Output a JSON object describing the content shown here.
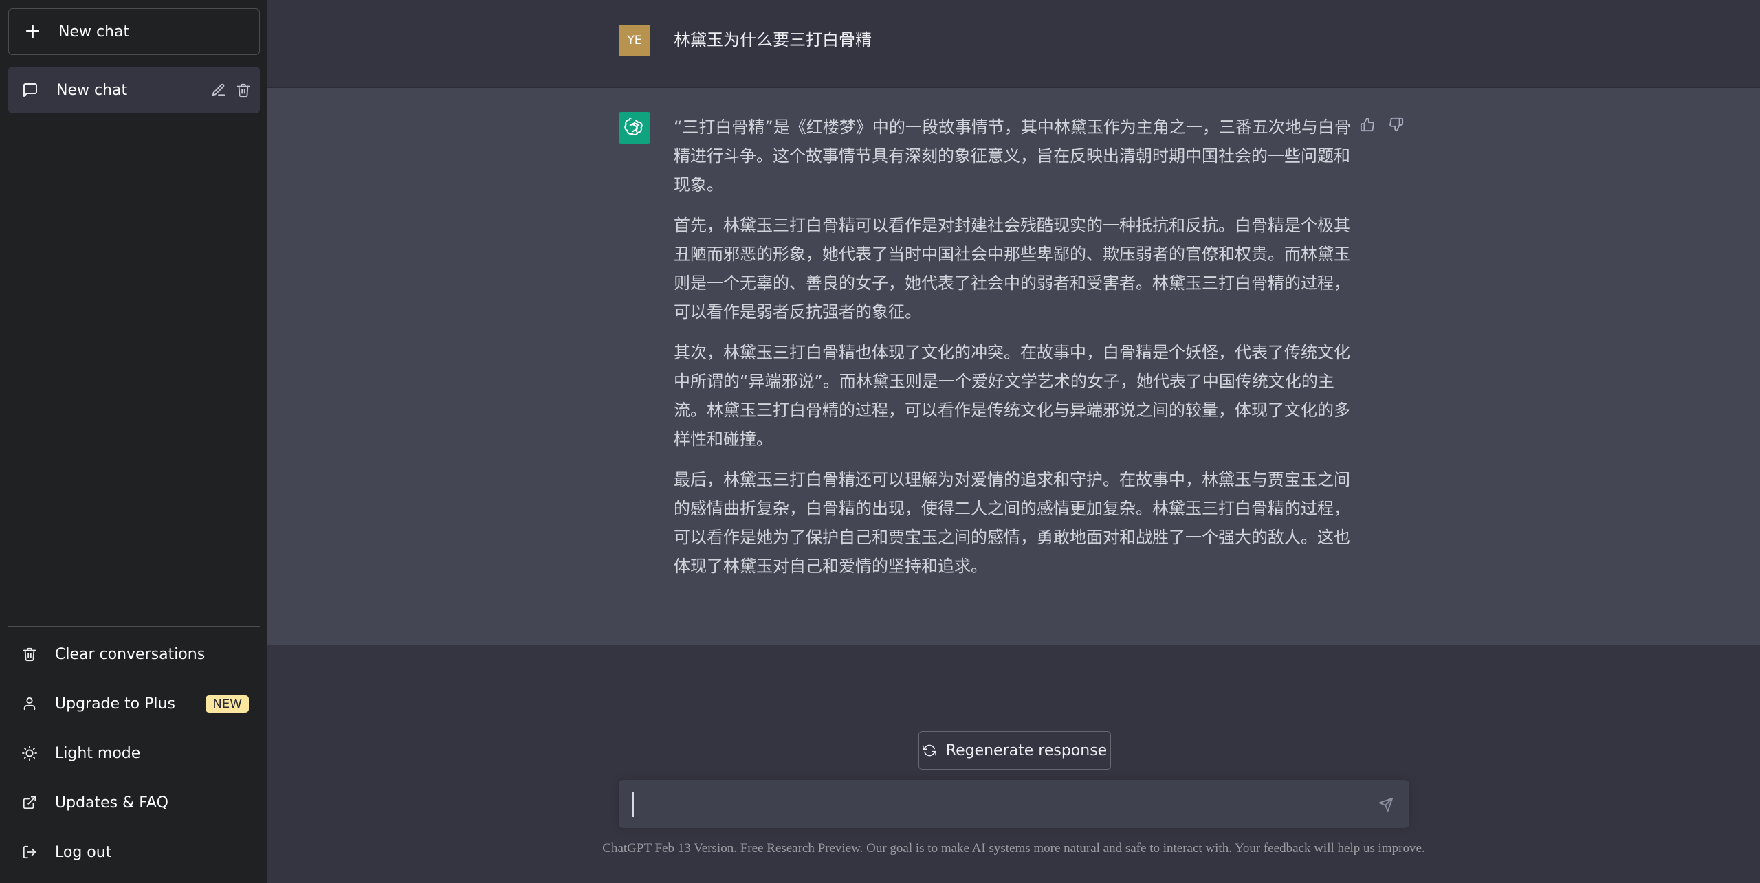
{
  "sidebar": {
    "new_chat_label": "New chat",
    "chats": [
      {
        "title": "New chat"
      }
    ],
    "menu": [
      {
        "label": "Clear conversations",
        "icon": "trash-icon"
      },
      {
        "label": "Upgrade to Plus",
        "icon": "user-icon",
        "badge": "NEW"
      },
      {
        "label": "Light mode",
        "icon": "sun-icon"
      },
      {
        "label": "Updates & FAQ",
        "icon": "external-link-icon"
      },
      {
        "label": "Log out",
        "icon": "logout-icon"
      }
    ]
  },
  "conversation": {
    "user": {
      "avatar_initials": "YE",
      "message": "林黛玉为什么要三打白骨精"
    },
    "assistant": {
      "paragraphs": [
        "“三打白骨精”是《红楼梦》中的一段故事情节，其中林黛玉作为主角之一，三番五次地与白骨精进行斗争。这个故事情节具有深刻的象征意义，旨在反映出清朝时期中国社会的一些问题和现象。",
        "首先，林黛玉三打白骨精可以看作是对封建社会残酷现实的一种抵抗和反抗。白骨精是个极其丑陋而邪恶的形象，她代表了当时中国社会中那些卑鄙的、欺压弱者的官僚和权贵。而林黛玉则是一个无辜的、善良的女子，她代表了社会中的弱者和受害者。林黛玉三打白骨精的过程，可以看作是弱者反抗强者的象征。",
        "其次，林黛玉三打白骨精也体现了文化的冲突。在故事中，白骨精是个妖怪，代表了传统文化中所谓的“异端邪说”。而林黛玉则是一个爱好文学艺术的女子，她代表了中国传统文化的主流。林黛玉三打白骨精的过程，可以看作是传统文化与异端邪说之间的较量，体现了文化的多样性和碰撞。",
        "最后，林黛玉三打白骨精还可以理解为对爱情的追求和守护。在故事中，林黛玉与贾宝玉之间的感情曲折复杂，白骨精的出现，使得二人之间的感情更加复杂。林黛玉三打白骨精的过程，可以看作是她为了保护自己和贾宝玉之间的感情，勇敢地面对和战胜了一个强大的敌人。这也体现了林黛玉对自己和爱情的坚持和追求。"
      ]
    }
  },
  "composer": {
    "regenerate_label": "Regenerate response",
    "input_value": "",
    "footer_link": "ChatGPT Feb 13 Version",
    "footer_text": ". Free Research Preview. Our goal is to make AI systems more natural and safe to interact with. Your feedback will help us improve."
  },
  "colors": {
    "sidebar_bg": "#202123",
    "main_bg": "#343541",
    "assistant_bg": "#444654",
    "accent": "#10a37f",
    "user_avatar": "#b8934f",
    "badge_bg": "#fae69e"
  }
}
